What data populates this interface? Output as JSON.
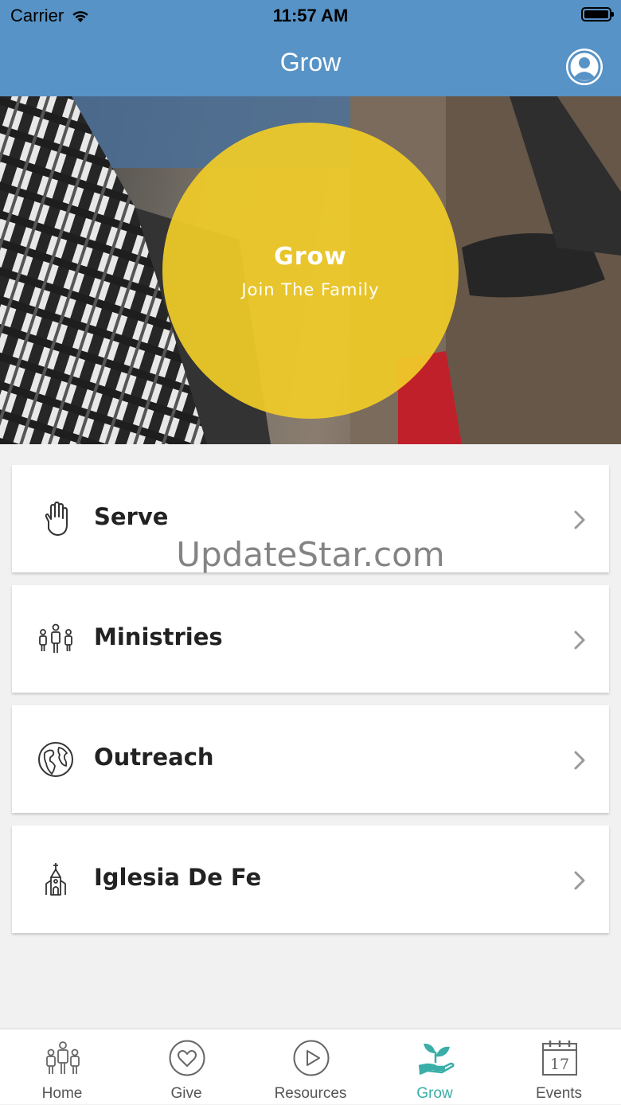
{
  "status": {
    "carrier": "Carrier",
    "time": "11:57 AM"
  },
  "nav": {
    "title": "Grow",
    "profile_icon": "profile-icon"
  },
  "hero": {
    "title": "Grow",
    "subtitle": "Join The Family",
    "accent": "#f0cb28"
  },
  "list": [
    {
      "label": "Serve",
      "icon": "hand-icon"
    },
    {
      "label": "Ministries",
      "icon": "people-icon"
    },
    {
      "label": "Outreach",
      "icon": "globe-icon"
    },
    {
      "label": "Iglesia De Fe",
      "icon": "church-icon"
    }
  ],
  "watermark": "UpdateStar.com",
  "tabs": [
    {
      "label": "Home",
      "icon": "people-icon",
      "active": false
    },
    {
      "label": "Give",
      "icon": "heart-icon",
      "active": false
    },
    {
      "label": "Resources",
      "icon": "play-icon",
      "active": false
    },
    {
      "label": "Grow",
      "icon": "sprout-icon",
      "active": true
    },
    {
      "label": "Events",
      "icon": "calendar-icon",
      "active": false,
      "calendar_day": "17"
    }
  ],
  "colors": {
    "nav": "#5793c6",
    "active_tab": "#3aaea7"
  }
}
